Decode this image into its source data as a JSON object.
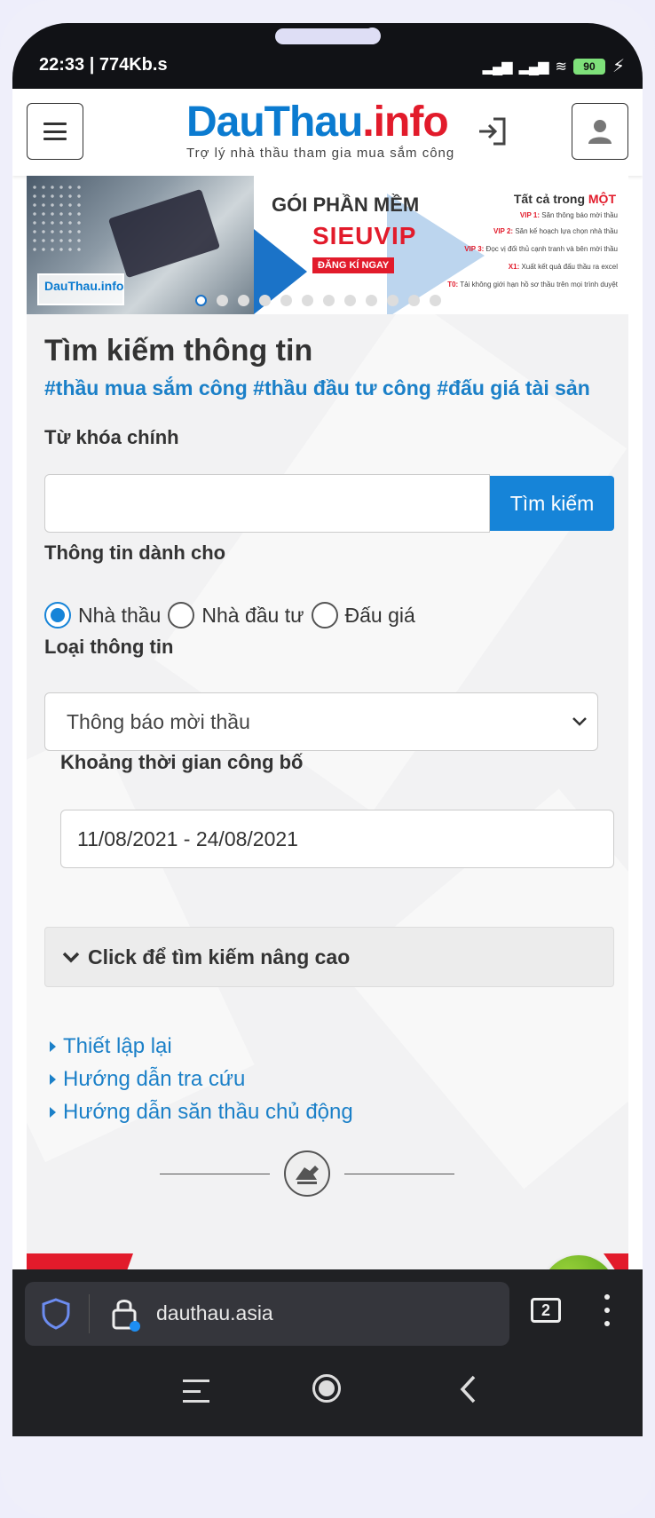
{
  "status": {
    "time_speed": "22:33 | 774Kb.s",
    "battery": "90"
  },
  "header": {
    "logo_text_1": "DauThau",
    "logo_text_2": ".info",
    "logo_tagline": "Trợ lý nhà thầu tham gia mua sắm công"
  },
  "banner": {
    "brand": "DauThau.info",
    "title": "GÓI PHẦN MỀM",
    "product": "SIEUVIP",
    "cta": "ĐĂNG KÍ NGAY",
    "right_title_1": "Tất cả trong",
    "right_title_2": "MỘT",
    "lines": [
      {
        "tag": "VIP 1:",
        "text": "Săn thông báo mời thầu"
      },
      {
        "tag": "VIP 2:",
        "text": "Săn kế hoạch lựa chọn nhà thầu"
      },
      {
        "tag": "VIP 3:",
        "text": "Đọc vị đối thủ cạnh tranh và bên mời thầu"
      },
      {
        "tag": "X1:",
        "text": "Xuất kết quả đấu thầu ra excel"
      },
      {
        "tag": "T0:",
        "text": "Tải không giới hạn hồ sơ thầu trên mọi trình duyệt"
      }
    ],
    "slide_count": 12,
    "active_slide": 1
  },
  "search": {
    "title": "Tìm kiếm thông tin",
    "tags": "#thầu mua sắm công #thầu đầu tư công #đấu giá tài sản",
    "keyword_label": "Từ khóa chính",
    "keyword_value": "",
    "search_button": "Tìm kiếm",
    "audience_label": "Thông tin dành cho",
    "audience_options": [
      "Nhà thầu",
      "Nhà đầu tư",
      "Đấu giá"
    ],
    "audience_selected": "Nhà thầu",
    "type_label": "Loại thông tin",
    "type_value": "Thông báo mời thầu",
    "date_label": "Khoảng thời gian công bố",
    "date_value": "11/08/2021 - 24/08/2021",
    "advanced": "Click để tìm kiếm nâng cao",
    "links": [
      "Thiết lập lại",
      "Hướng dẫn tra cứu",
      "Hướng dẫn săn thầu chủ động"
    ]
  },
  "browser": {
    "url": "dauthau.asia",
    "tab_count": "2"
  }
}
